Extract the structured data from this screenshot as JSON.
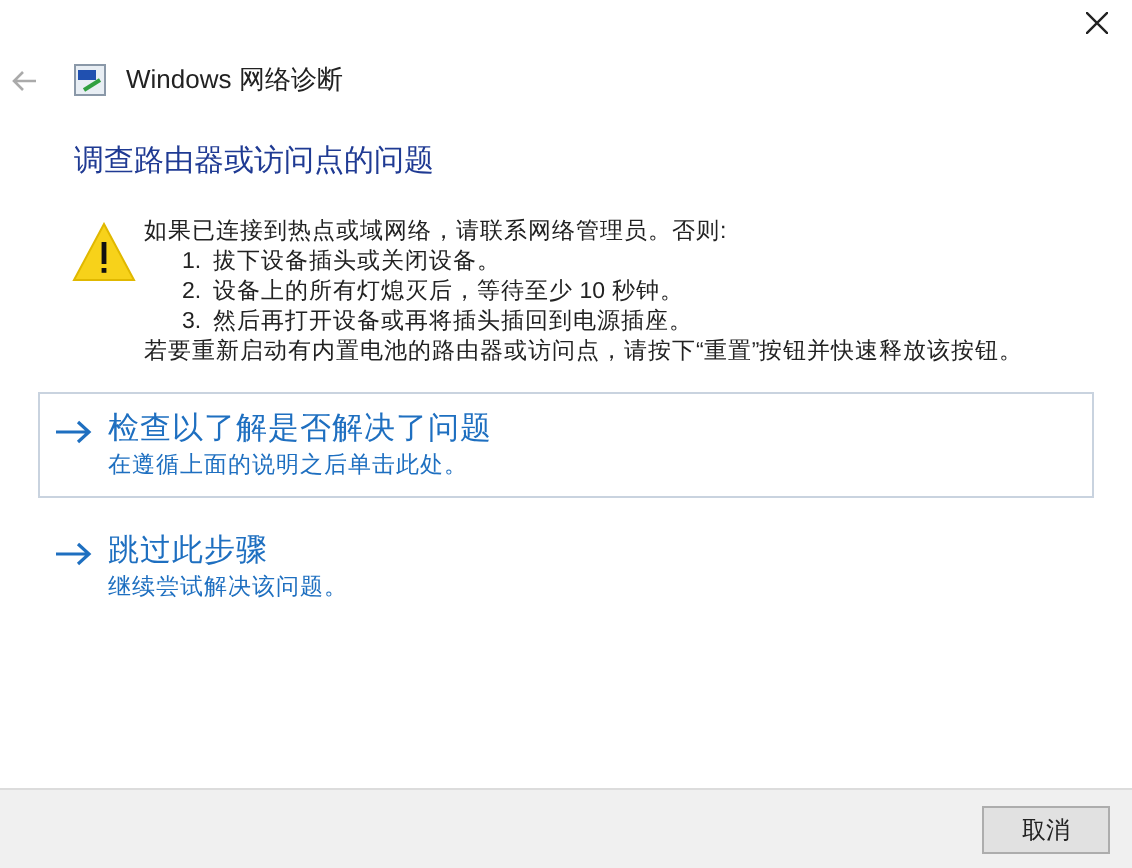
{
  "window": {
    "title": "Windows 网络诊断"
  },
  "heading": "调查路由器或访问点的问题",
  "message": {
    "intro": "如果已连接到热点或域网络，请联系网络管理员。否则:",
    "steps": [
      {
        "number": "1.",
        "text": "拔下设备插头或关闭设备。"
      },
      {
        "number": "2.",
        "text": "设备上的所有灯熄灭后，等待至少 10 秒钟。"
      },
      {
        "number": "3.",
        "text": "然后再打开设备或再将插头插回到电源插座。"
      }
    ],
    "note": "若要重新启动有内置电池的路由器或访问点，请按下“重置”按钮并快速释放该按钮。"
  },
  "options": [
    {
      "title": "检查以了解是否解决了问题",
      "subtitle": "在遵循上面的说明之后单击此处。",
      "selected": true
    },
    {
      "title": "跳过此步骤",
      "subtitle": "继续尝试解决该问题。",
      "selected": false
    }
  ],
  "buttons": [
    "取消"
  ]
}
